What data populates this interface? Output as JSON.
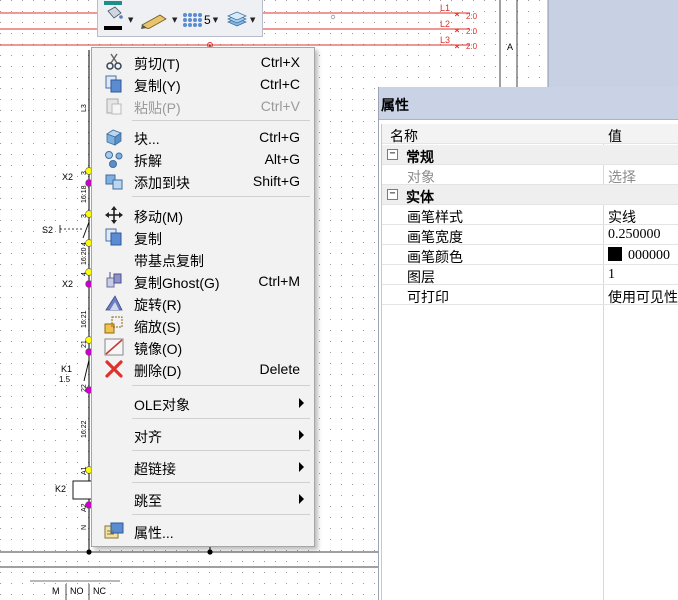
{
  "schematic": {
    "phase_labels": [
      "L1",
      "L2",
      "L3"
    ],
    "phase_values": [
      "2:0",
      "2:0",
      "2:0"
    ],
    "column_label": "A",
    "wire_label": "L3",
    "components": [
      "X2",
      "S2",
      "X2",
      "K1",
      "1.5",
      "K2"
    ],
    "pin_labels": [
      "3",
      "3",
      "16:18",
      "4",
      "16:20",
      "4",
      "16:21",
      "21",
      "22",
      "16:22",
      "A1",
      "A2",
      "N"
    ],
    "footer_headers": [
      "M",
      "NO",
      "NC"
    ]
  },
  "toolbar": {
    "line_width_value": "5"
  },
  "context_menu": {
    "items": [
      {
        "icon": "scissors-icon",
        "label": "剪切(T)",
        "shortcut": "Ctrl+X"
      },
      {
        "icon": "copy-icon",
        "label": "复制(Y)",
        "shortcut": "Ctrl+C"
      },
      {
        "icon": "paste-icon",
        "label": "粘贴(P)",
        "shortcut": "Ctrl+V",
        "disabled": true
      },
      {
        "icon": "block-icon",
        "label": "块...",
        "shortcut": "Ctrl+G"
      },
      {
        "icon": "explode-icon",
        "label": "拆解",
        "shortcut": "Alt+G"
      },
      {
        "icon": "add-to-block-icon",
        "label": "添加到块",
        "shortcut": "Shift+G"
      },
      {
        "icon": "move-icon",
        "label": "移动(M)",
        "shortcut": ""
      },
      {
        "icon": "copy-icon",
        "label": "复制",
        "shortcut": ""
      },
      {
        "icon": "",
        "label": "带基点复制",
        "shortcut": ""
      },
      {
        "icon": "ghost-copy-icon",
        "label": "复制Ghost(G)",
        "shortcut": "Ctrl+M"
      },
      {
        "icon": "rotate-icon",
        "label": "旋转(R)",
        "shortcut": ""
      },
      {
        "icon": "scale-icon",
        "label": "缩放(S)",
        "shortcut": ""
      },
      {
        "icon": "mirror-icon",
        "label": "镜像(O)",
        "shortcut": ""
      },
      {
        "icon": "delete-icon",
        "label": "删除(D)",
        "shortcut": "Delete"
      },
      {
        "icon": "",
        "label": "OLE对象",
        "submenu": true
      },
      {
        "icon": "",
        "label": "对齐",
        "submenu": true
      },
      {
        "icon": "",
        "label": "超链接",
        "submenu": true
      },
      {
        "icon": "",
        "label": "跳至",
        "submenu": true
      },
      {
        "icon": "properties-icon",
        "label": "属性...",
        "shortcut": ""
      }
    ]
  },
  "properties": {
    "title": "属性",
    "header": {
      "name": "名称",
      "value": "值"
    },
    "general": {
      "title": "常规",
      "rows": [
        {
          "name": "对象",
          "value": "选择",
          "disabled": true
        }
      ]
    },
    "entity": {
      "title": "实体",
      "rows": [
        {
          "name": "画笔样式",
          "value": "实线"
        },
        {
          "name": "画笔宽度",
          "value": "0.250000"
        },
        {
          "name": "画笔颜色",
          "value": "000000",
          "swatch": "#000000"
        },
        {
          "name": "图层",
          "value": "1"
        },
        {
          "name": "可打印",
          "value": "使用可见性"
        }
      ]
    }
  },
  "colors": {
    "wire_red": "#e0302a",
    "wire_black": "#000000",
    "junction_magenta": "#cc00cc",
    "junction_yellow": "#ffff00",
    "panel_title_bg": "#c9d3e5",
    "background_panel_blue": "#c8d1e4"
  }
}
